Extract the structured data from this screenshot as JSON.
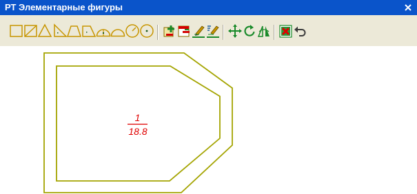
{
  "window": {
    "title": "РТ Элементарные фигуры",
    "close_glyph": "×"
  },
  "colors": {
    "title_bar": "#0a54ca",
    "toolbar_bg": "#ece9d8",
    "shape_icon": "#c79500",
    "edit_icon": "#1a8a2a",
    "outline": "#a4a400",
    "label": "#e00000"
  },
  "toolbar": {
    "tools": [
      {
        "name": "rectangle-tool"
      },
      {
        "name": "rectangle-diagonal-tool"
      },
      {
        "name": "triangle-tool"
      },
      {
        "name": "right-triangle-tool"
      },
      {
        "name": "trapezoid-tool"
      },
      {
        "name": "trapezoid-right-tool"
      },
      {
        "name": "semicircle-center-tool"
      },
      {
        "name": "semicircle-tool"
      },
      {
        "name": "circle-radius-tool"
      },
      {
        "name": "circle-center-tool"
      },
      {
        "name": "add-figure-tool"
      },
      {
        "name": "edit-figure-tool"
      },
      {
        "name": "edit-text-tool"
      },
      {
        "name": "edit-properties-tool"
      },
      {
        "name": "move-tool"
      },
      {
        "name": "rotate-tool"
      },
      {
        "name": "mirror-tool"
      },
      {
        "name": "delete-tool"
      },
      {
        "name": "undo-tool"
      }
    ]
  },
  "figure": {
    "number": "1",
    "area": "18.8"
  }
}
